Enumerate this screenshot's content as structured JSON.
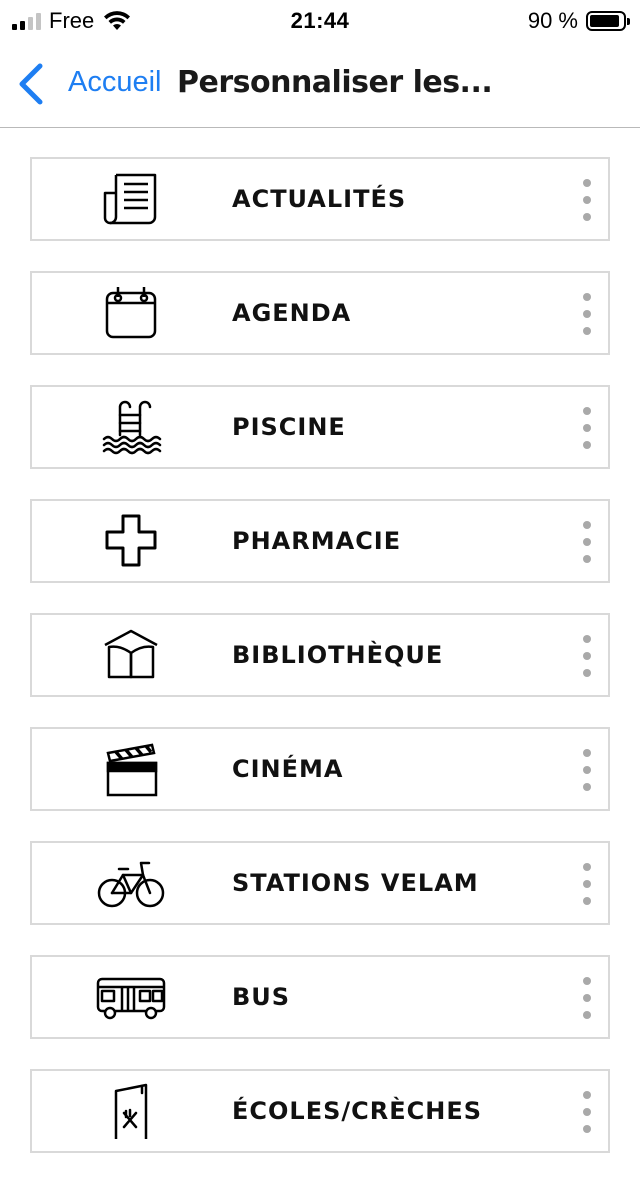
{
  "status_bar": {
    "carrier": "Free",
    "time": "21:44",
    "battery": "90 %",
    "battery_level": 0.9
  },
  "nav": {
    "back_label": "Accueil",
    "title": "Personnaliser les..."
  },
  "items": [
    {
      "label": "ACTUALITÉS",
      "icon": "newspaper-icon"
    },
    {
      "label": "AGENDA",
      "icon": "calendar-icon"
    },
    {
      "label": "PISCINE",
      "icon": "pool-icon"
    },
    {
      "label": "PHARMACIE",
      "icon": "pharmacy-cross-icon"
    },
    {
      "label": "BIBLIOTHÈQUE",
      "icon": "library-book-icon"
    },
    {
      "label": "CINÉMA",
      "icon": "clapperboard-icon"
    },
    {
      "label": "STATIONS VELAM",
      "icon": "bicycle-icon"
    },
    {
      "label": "BUS",
      "icon": "bus-icon"
    },
    {
      "label": "ÉCOLES/CRÈCHES",
      "icon": "school-menu-icon"
    }
  ]
}
